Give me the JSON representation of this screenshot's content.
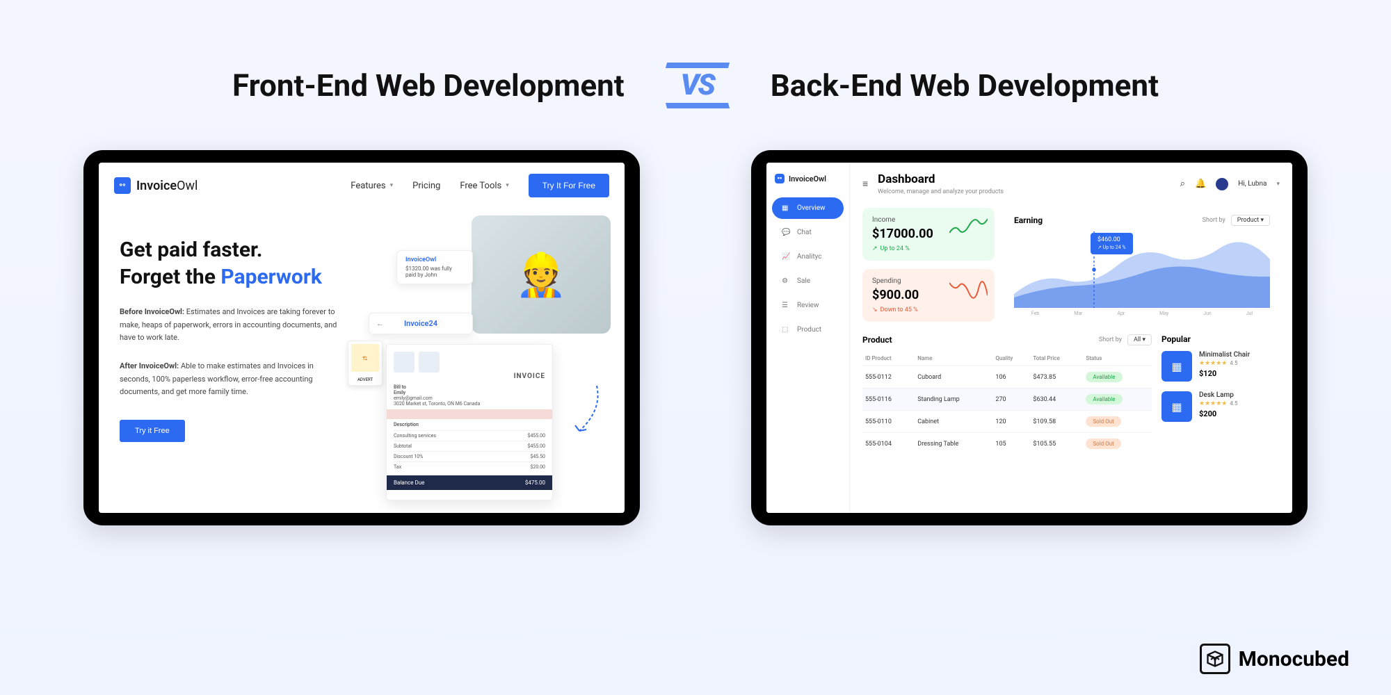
{
  "header": {
    "left_title": "Front-End Web Development",
    "right_title": "Back-End Web Development",
    "vs": "VS"
  },
  "frontend": {
    "logo": "InvoiceOwl",
    "nav": {
      "features": "Features",
      "pricing": "Pricing",
      "freetools": "Free Tools"
    },
    "cta": "Try It For Free",
    "hero_line1": "Get paid faster.",
    "hero_line2_a": "Forget the ",
    "hero_line2_b": "Paperwork",
    "before_label": "Before InvoiceOwl:",
    "before_text": " Estimates and Invoices are taking forever to make, heaps of paperwork, errors in accounting documents, and have to work late.",
    "after_label": "After InvoiceOwl:",
    "after_text": " Able to make estimates and Invoices in seconds, 100% paperless workflow, error-free accounting documents, and get more family time.",
    "try_btn": "Try it Free",
    "paid_card_logo": "InvoiceOwl",
    "paid_card_text": "$1320.00 was fully paid by John",
    "invoice_tab": "Invoice24",
    "advert_label": "ADVERT",
    "invoice_title": "INVOICE",
    "invoice_to": "Bill to",
    "invoice_email": "emily@gmail.com",
    "invoice_addr": "3020 Market st, Toronto, ON M6 Canada",
    "invoice_desc": "Description",
    "invoice_sub_l": "Subtotal",
    "invoice_sub_v": "$455.00",
    "invoice_disc_l": "Discount 10%",
    "invoice_disc_v": "$45.50",
    "invoice_tax_l": "Tax",
    "invoice_tax_v": "$20.00",
    "invoice_total_l": "Balance Due",
    "invoice_total_v": "$475.00"
  },
  "backend": {
    "logo": "InvoiceOwl",
    "sidebar": {
      "overview": "Overview",
      "chat": "Chat",
      "analytic": "Analityc",
      "sale": "Sale",
      "review": "Review",
      "product": "Product"
    },
    "dash_title": "Dashboard",
    "dash_sub": "Welcome, manage and analyze your products",
    "user_name": "Hi, Lubna",
    "income_label": "Income",
    "income_value": "$17000.00",
    "income_delta": "Up to 24 %",
    "spending_label": "Spending",
    "spending_value": "$900.00",
    "spending_delta": "Down to 45 %",
    "earning_title": "Earning",
    "short_by_label": "Short by",
    "short_by_value": "Product",
    "tooltip_value": "$460.00",
    "tooltip_delta": "Up to 24 %",
    "xaxis": [
      "Feb",
      "Mar",
      "Apr",
      "May",
      "Jun",
      "Jul"
    ],
    "product_title": "Product",
    "filter_label": "Short by",
    "filter_value": "All",
    "cols": {
      "id": "ID Product",
      "name": "Name",
      "qty": "Quality",
      "price": "Total Price",
      "status": "Status"
    },
    "rows": [
      {
        "id": "555-0112",
        "name": "Cuboard",
        "qty": "106",
        "price": "$473.85",
        "status": "Available",
        "cls": "avail"
      },
      {
        "id": "555-0116",
        "name": "Standing Lamp",
        "qty": "270",
        "price": "$630.44",
        "status": "Available",
        "cls": "avail",
        "hl": true
      },
      {
        "id": "555-0110",
        "name": "Cabinet",
        "qty": "120",
        "price": "$109.58",
        "status": "Sold Out",
        "cls": "sold"
      },
      {
        "id": "555-0104",
        "name": "Dressing Table",
        "qty": "105",
        "price": "$105.55",
        "status": "Sold Out",
        "cls": "sold"
      }
    ],
    "popular_title": "Popular",
    "popular": [
      {
        "name": "Minimalist Chair",
        "rating": "4.5",
        "price": "$120"
      },
      {
        "name": "Desk Lamp",
        "rating": "4.5",
        "price": "$200"
      }
    ]
  },
  "footer_brand": "Monocubed"
}
